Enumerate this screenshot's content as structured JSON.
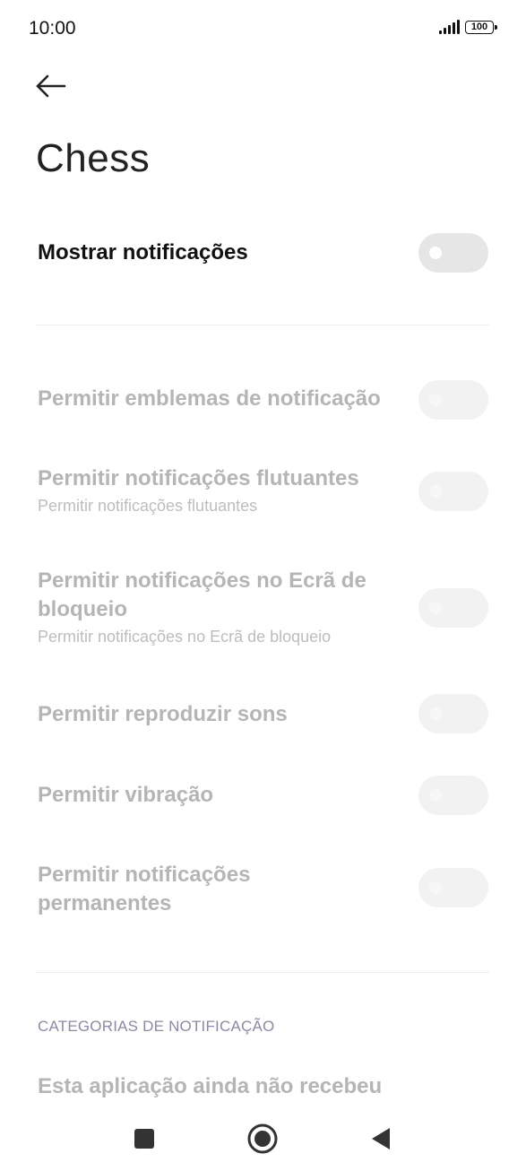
{
  "status": {
    "time": "10:00",
    "battery": "100"
  },
  "header": {
    "back_icon": "arrow-left-icon",
    "title": "Chess"
  },
  "main_toggle": {
    "label": "Mostrar notificações",
    "on": false
  },
  "settings": [
    {
      "label": "Permitir emblemas de notificação",
      "on": false,
      "enabled": false
    },
    {
      "label": "Permitir notificações flutuantes",
      "sub": "Permitir notificações flutuantes",
      "on": false,
      "enabled": false
    },
    {
      "label": "Permitir notificações no Ecrã de bloqueio",
      "sub": "Permitir notificações no Ecrã de bloqueio",
      "on": false,
      "enabled": false
    },
    {
      "label": "Permitir reproduzir sons",
      "on": false,
      "enabled": false
    },
    {
      "label": "Permitir vibração",
      "on": false,
      "enabled": false
    },
    {
      "label": "Permitir notificações permanentes",
      "on": false,
      "enabled": false
    }
  ],
  "categories": {
    "header": "CATEGORIAS DE NOTIFICAÇÃO",
    "empty_message": "Esta aplicação ainda não recebeu"
  },
  "nav": {
    "recents_icon": "square-icon",
    "home_icon": "circle-icon",
    "back_icon": "triangle-back-icon"
  }
}
